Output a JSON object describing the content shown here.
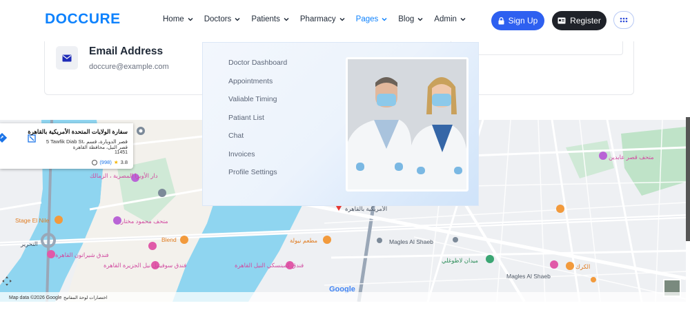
{
  "brand": {
    "logo_text": "DOCCURE",
    "accent": "#0e82fd",
    "dark_button": "#1f2229",
    "primary_button": "#2e60f0"
  },
  "nav": {
    "items": [
      {
        "label": "Home",
        "active": false
      },
      {
        "label": "Doctors",
        "active": false
      },
      {
        "label": "Patients",
        "active": false
      },
      {
        "label": "Pharmacy",
        "active": false
      },
      {
        "label": "Pages",
        "active": true
      },
      {
        "label": "Blog",
        "active": false
      },
      {
        "label": "Admin",
        "active": false
      }
    ],
    "signup_label": "Sign Up",
    "register_label": "Register",
    "icons": {
      "signup": "lock-icon",
      "register": "id-card-icon",
      "menu": "grid-dots-icon",
      "chevron": "chevron-down-icon"
    }
  },
  "contact": {
    "email_title": "Email Address",
    "email_value": "doccure@example.com",
    "icon": "mail-icon"
  },
  "pages_dropdown": {
    "items": [
      "Doctor Dashboard",
      "Appointments",
      "Valiable Timing",
      "Patiant List",
      "Chat",
      "Invoices",
      "Profile Settings"
    ],
    "image": "doctors-photo"
  },
  "map": {
    "info_window": {
      "title": "سفارة الولايات المتحدة الأمريكية بالقاهرة",
      "address_line1": "5 Tawfik Diab St، قصر الدوبارة، قسم",
      "address_line2": "قصر النيل، محافظة القاهرة",
      "address_line3": "11451",
      "rating": "3.8",
      "reviews": "(998)"
    },
    "labels": {
      "stage_el_nile": "Stage El Nile",
      "blend": "Blend",
      "magles1": "Magles Al Shaeb",
      "magles2": "Magles Al Shaeb",
      "opera": "دار الأوبرا المصرية ، الزمالك",
      "mukhtar": "متحف محمود مختار",
      "sheraton": "فندق شيراتون القاهرة",
      "sofitel": "فندق سوفيتيل نيل الجزيرة القاهرة",
      "kempinski": "فندق كمبنسكي النيل القاهرة",
      "abdeen": "متحف قصر عابدين",
      "tahrir": "التحرير",
      "maadi_cafe": "مطعم نيولة",
      "karak": "الكرك",
      "lazoghly": "ميدان لاظوغلي",
      "embassy_short": "الأمريكية بالقاهرة"
    },
    "footer": {
      "map_data": "Map data ©2026 Google",
      "shortcuts": "اختصارات لوحة المفاتيح",
      "google": "Google"
    }
  }
}
